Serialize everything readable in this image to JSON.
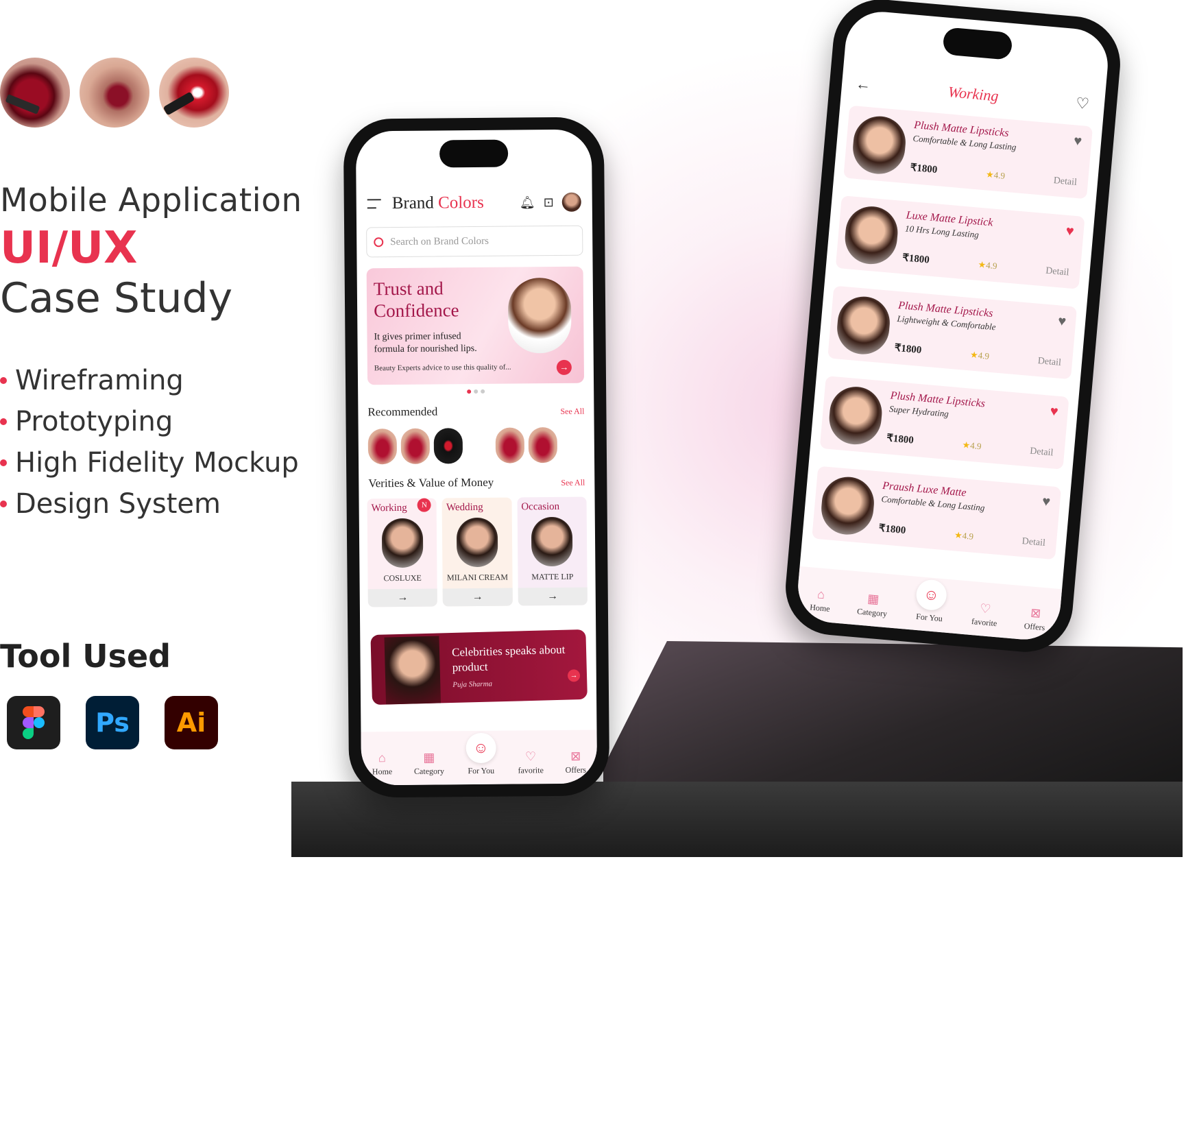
{
  "left": {
    "heading_line1": "Mobile Application",
    "heading_line2": "UI/UX",
    "heading_line3": "Case Study",
    "bullets": [
      "Wireframing",
      "Prototyping",
      "High Fidelity Mockup",
      "Design System"
    ],
    "tools_title": "Tool Used",
    "tools": [
      {
        "name": "Figma",
        "label": ""
      },
      {
        "name": "Photoshop",
        "label": "Ps"
      },
      {
        "name": "Illustrator",
        "label": "Ai"
      }
    ]
  },
  "home": {
    "brand_word1": "Brand",
    "brand_word2": "Colors",
    "search_placeholder": "Search on Brand Colors",
    "banner": {
      "title": "Trust and Confidence",
      "text": "It gives primer infused formula for nourished lips.",
      "footer": "Beauty Experts advice to use this quality of..."
    },
    "recommended_title": "Recommended",
    "see_all": "See All",
    "varieties_title": "Verities & Value of Money",
    "varieties": [
      {
        "label": "Working",
        "caption": "COSLUXE",
        "badge": "N"
      },
      {
        "label": "Wedding",
        "caption": "MILANI CREAM",
        "badge": ""
      },
      {
        "label": "Occasion",
        "caption": "MATTE LIP",
        "badge": ""
      }
    ],
    "celeb": {
      "title": "Celebrities speaks about product",
      "by": "Puja Sharma"
    }
  },
  "tabs": [
    {
      "label": "Home",
      "icon": "home-icon"
    },
    {
      "label": "Category",
      "icon": "category-icon"
    },
    {
      "label": "For You",
      "icon": "for-you-icon"
    },
    {
      "label": "favorite",
      "icon": "heart-icon"
    },
    {
      "label": "Offers",
      "icon": "offers-icon"
    }
  ],
  "working": {
    "title": "Working",
    "products": [
      {
        "name": "Plush Matte Lipsticks",
        "sub": "Comfortable & Long Lasting",
        "price": "₹1800",
        "rating": "4.9",
        "detail": "Detail",
        "fav": false
      },
      {
        "name": "Luxe Matte Lipstick",
        "sub": "10 Hrs Long Lasting",
        "price": "₹1800",
        "rating": "4.9",
        "detail": "Detail",
        "fav": true
      },
      {
        "name": "Plush Matte Lipsticks",
        "sub": "Lightweight & Comfortable",
        "price": "₹1800",
        "rating": "4.9",
        "detail": "Detail",
        "fav": false
      },
      {
        "name": "Plush Matte Lipsticks",
        "sub": "Super Hydrating",
        "price": "₹1800",
        "rating": "4.9",
        "detail": "Detail",
        "fav": true
      },
      {
        "name": "Praush Luxe Matte",
        "sub": "Comfortable & Long Lasting",
        "price": "₹1800",
        "rating": "4.9",
        "detail": "Detail",
        "fav": false
      }
    ]
  },
  "colors": {
    "accent": "#e8334f",
    "brand_dark": "#a3174a"
  }
}
